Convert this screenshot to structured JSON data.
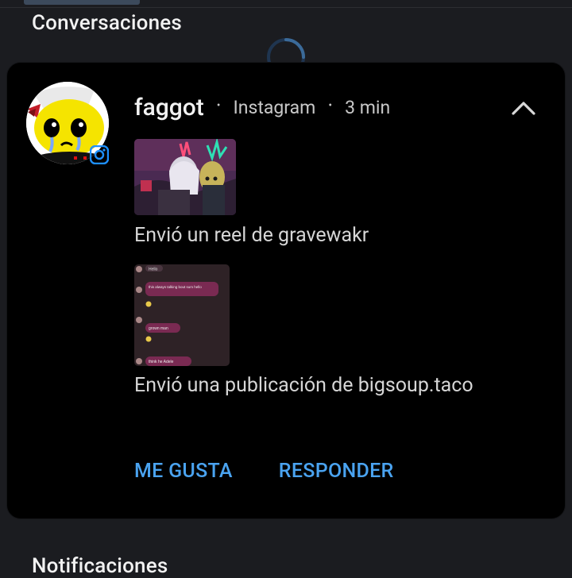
{
  "sections": {
    "conversations_title": "Conversaciones",
    "notifications_title": "Notificaciones"
  },
  "notification": {
    "sender": "faggot",
    "app": "Instagram",
    "time": "3 min",
    "separator": "•",
    "avatar_icon": "cartoon-face-avatar",
    "badge_icon": "instagram-icon",
    "collapse_icon": "chevron-up-icon",
    "messages": [
      {
        "text": "Envió un reel de gravewakr",
        "thumbnail": "reel-thumbnail"
      },
      {
        "text": "Envió una publicación de bigsoup.taco",
        "thumbnail": "chat-screenshot-thumbnail"
      }
    ],
    "post_chat_snippets": [
      "Hello",
      "this always talking bout sum hello",
      "grown man",
      "think he Adele"
    ],
    "actions": {
      "like": "ME GUSTA",
      "reply": "RESPONDER"
    }
  },
  "colors": {
    "background": "#1b1c20",
    "card": "#000000",
    "accent": "#4aa3f0",
    "badge": "#1e90ff"
  }
}
